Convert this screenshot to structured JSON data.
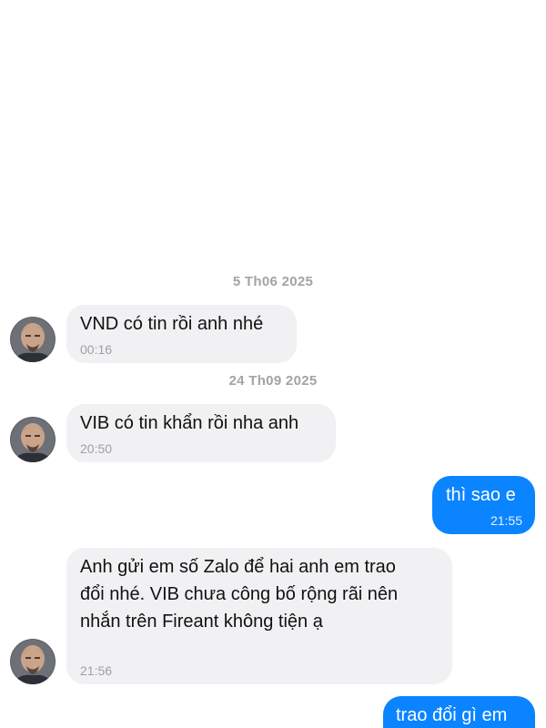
{
  "conversation": {
    "date_separators": [
      "5 Th06 2025",
      "24 Th09 2025"
    ],
    "messages": [
      {
        "direction": "incoming",
        "text": "VND có tin rồi anh nhé",
        "time": "00:16"
      },
      {
        "direction": "incoming",
        "text": "VIB có tin khẩn rồi nha anh",
        "time": "20:50"
      },
      {
        "direction": "outgoing",
        "text": "thì sao e",
        "time": "21:55"
      },
      {
        "direction": "incoming",
        "lines": [
          "Anh gửi em số Zalo để hai anh em trao",
          "đổi nhé. VIB chưa công bố rộng rãi nên",
          "nhắn trên Fireant không tiện ạ"
        ],
        "time": "21:56"
      },
      {
        "direction": "outgoing",
        "text": "trao đổi gì em",
        "time": ""
      }
    ]
  },
  "colors": {
    "incoming_bubble": "#f1f1f3",
    "outgoing_bubble": "#0a84ff",
    "timestamp_gray": "#a0a0a5",
    "date_separator": "#a3a3a8"
  },
  "icons": {
    "avatar": "sender-avatar"
  }
}
